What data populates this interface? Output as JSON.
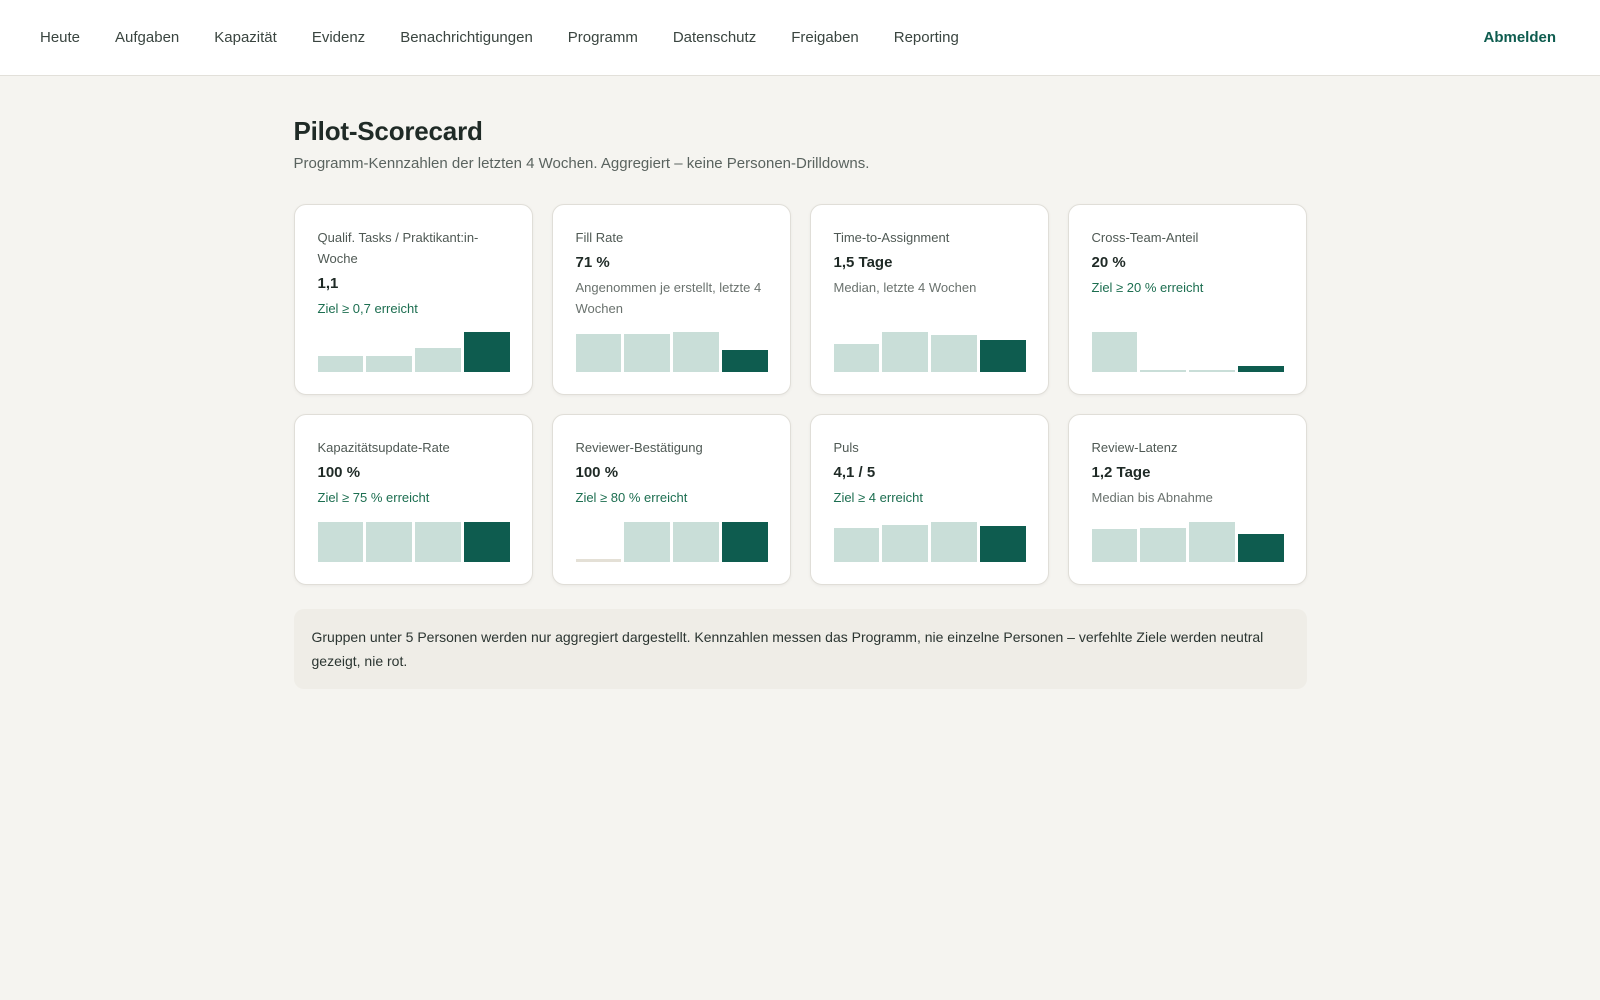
{
  "nav": {
    "items": [
      "Heute",
      "Aufgaben",
      "Kapazität",
      "Evidenz",
      "Benachrichtigungen",
      "Programm",
      "Datenschutz",
      "Freigaben",
      "Reporting"
    ],
    "logout_label": "Abmelden"
  },
  "page": {
    "title": "Pilot-Scorecard",
    "subtitle": "Programm-Kennzahlen der letzten 4 Wochen. Aggregiert – keine Personen-Drilldowns."
  },
  "cards": [
    {
      "label": "Qualif. Tasks / Praktikant:in-Woche",
      "value": "1,1",
      "note": "Ziel ≥ 0,7 erreicht",
      "note_type": "success",
      "weekly_levels": [
        0.4,
        0.4,
        0.6,
        1.0
      ]
    },
    {
      "label": "Fill Rate",
      "value": "71 %",
      "note": "Angenommen je erstellt, letzte 4 Wochen",
      "note_type": "muted",
      "weekly_levels": [
        0.95,
        0.95,
        1.0,
        0.55
      ]
    },
    {
      "label": "Time-to-Assignment",
      "value": "1,5 Tage",
      "note": "Median, letzte 4 Wochen",
      "note_type": "muted",
      "weekly_levels": [
        0.7,
        1.0,
        0.92,
        0.8
      ]
    },
    {
      "label": "Cross-Team-Anteil",
      "value": "20 %",
      "note": "Ziel ≥ 20 % erreicht",
      "note_type": "success",
      "weekly_levels": [
        1.0,
        0.04,
        0.04,
        0.16
      ]
    },
    {
      "label": "Kapazitätsupdate-Rate",
      "value": "100 %",
      "note": "Ziel ≥ 75 % erreicht",
      "note_type": "success",
      "weekly_levels": [
        1.0,
        1.0,
        1.0,
        1.0
      ]
    },
    {
      "label": "Reviewer-Bestätigung",
      "value": "100 %",
      "note": "Ziel ≥ 80 % erreicht",
      "note_type": "success",
      "weekly_levels": [
        0.0,
        1.0,
        1.0,
        1.0
      ]
    },
    {
      "label": "Puls",
      "value": "4,1 / 5",
      "note": "Ziel ≥ 4 erreicht",
      "note_type": "success",
      "weekly_levels": [
        0.85,
        0.92,
        1.0,
        0.9
      ]
    },
    {
      "label": "Review-Latenz",
      "value": "1,2 Tage",
      "note": "Median bis Abnahme",
      "note_type": "muted",
      "weekly_levels": [
        0.82,
        0.85,
        1.0,
        0.7
      ]
    }
  ],
  "footnote": "Gruppen unter 5 Personen werden nur aggregiert dargestellt. Kennzahlen messen das Programm, nie einzelne Personen – verfehlte Ziele werden neutral gezeigt, nie rot.",
  "colors": {
    "accent": "#0e5c4f",
    "bar_previous": "#c9ded8",
    "success_text": "#1c6e50",
    "background": "#f5f4f0"
  }
}
